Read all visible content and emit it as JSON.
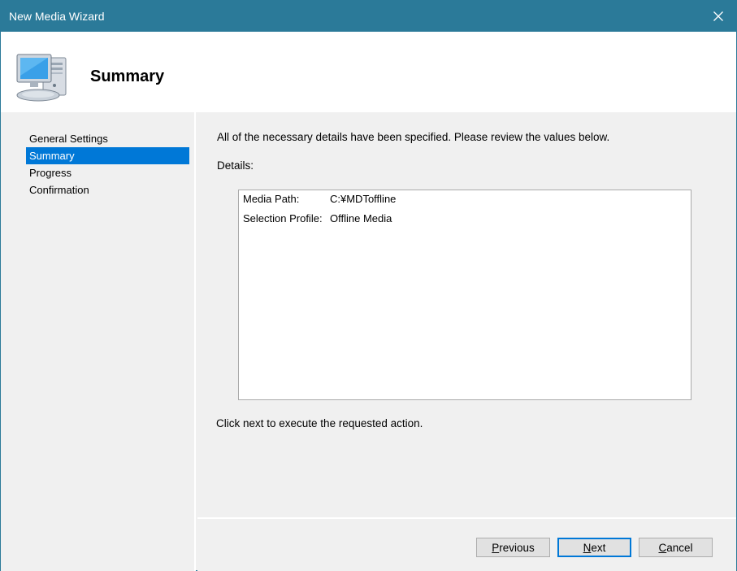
{
  "window": {
    "title": "New Media Wizard"
  },
  "header": {
    "title": "Summary",
    "icon": "computer-icon"
  },
  "sidebar": {
    "items": [
      {
        "label": "General Settings",
        "active": false
      },
      {
        "label": "Summary",
        "active": true
      },
      {
        "label": "Progress",
        "active": false
      },
      {
        "label": "Confirmation",
        "active": false
      }
    ]
  },
  "content": {
    "intro": "All of the necessary details have been specified.  Please review the values below.",
    "details_label": "Details:",
    "details": [
      {
        "key": "Media Path:",
        "value": "C:¥MDToffline"
      },
      {
        "key": "Selection Profile:",
        "value": "Offline Media"
      }
    ],
    "footer_text": "Click next to execute the requested action."
  },
  "buttons": {
    "previous": {
      "access_key": "P",
      "rest": "revious"
    },
    "next": {
      "access_key": "N",
      "rest": "ext"
    },
    "cancel": {
      "access_key": "C",
      "rest": "ancel"
    }
  },
  "colors": {
    "titlebar": "#2b7a99",
    "selection": "#0078d7"
  }
}
